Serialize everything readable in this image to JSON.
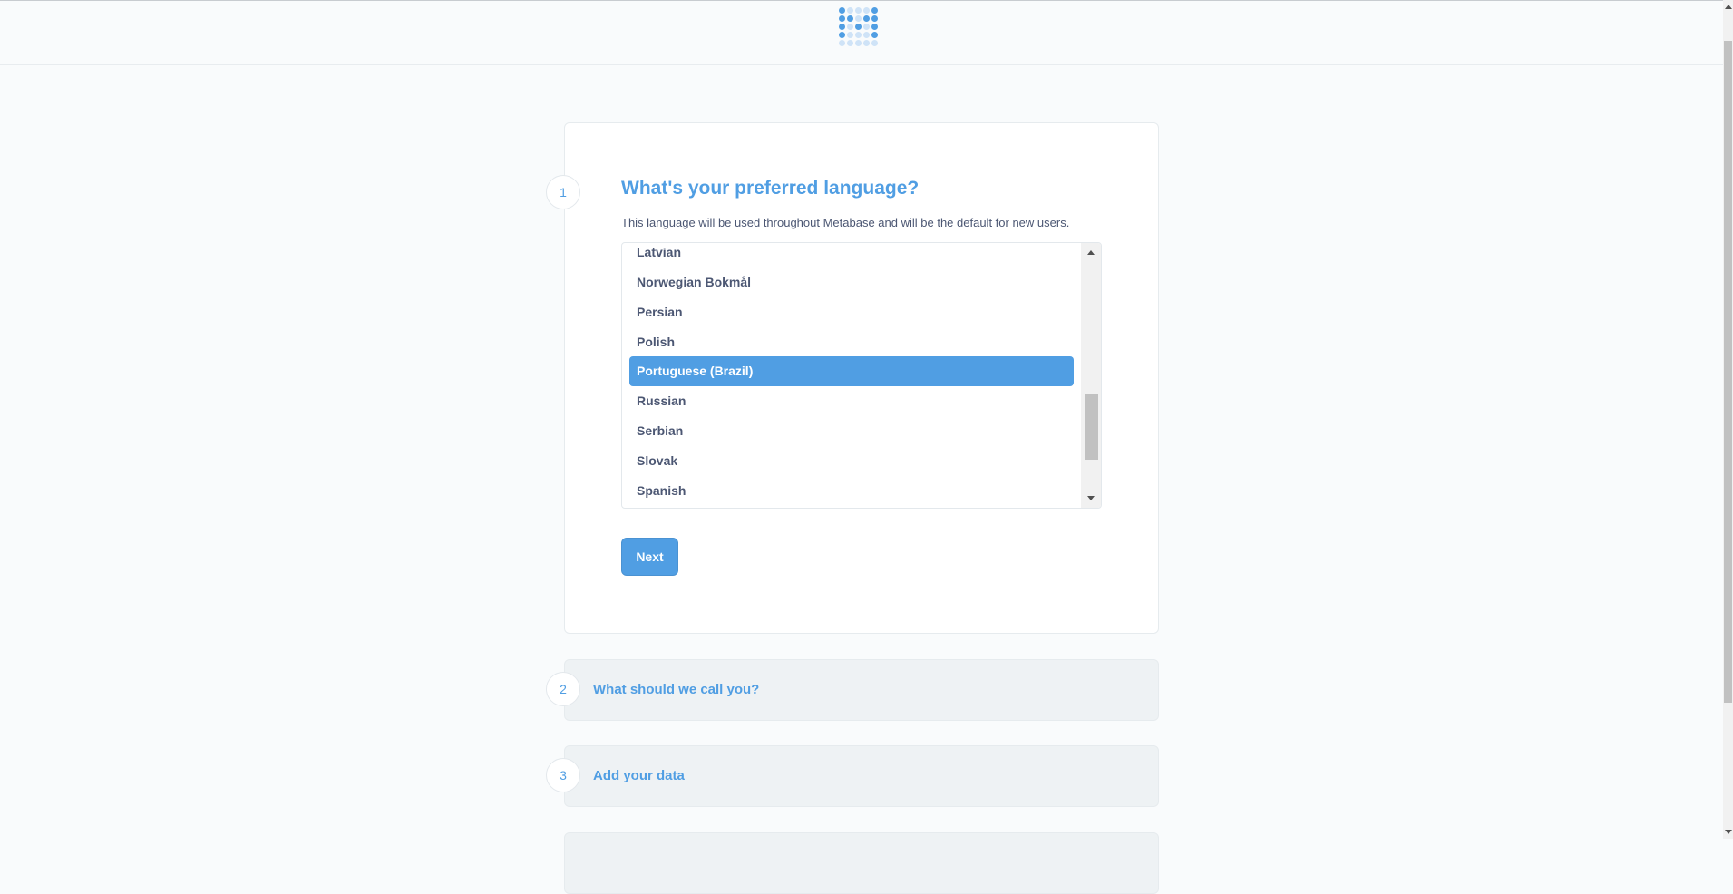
{
  "colors": {
    "brand": "#509ee3",
    "text_dark": "#4c5773",
    "background": "#f9fbfc"
  },
  "header": {
    "logo_icon": "metabase-logo"
  },
  "step1": {
    "number": "1",
    "title": "What's your preferred language?",
    "description": "This language will be used throughout Metabase and will be the default for new users.",
    "languages": [
      "Latvian",
      "Norwegian Bokmål",
      "Persian",
      "Polish",
      "Portuguese (Brazil)",
      "Russian",
      "Serbian",
      "Slovak",
      "Spanish"
    ],
    "selected": "Portuguese (Brazil)",
    "next_label": "Next"
  },
  "step2": {
    "number": "2",
    "title": "What should we call you?"
  },
  "step3": {
    "number": "3",
    "title": "Add your data"
  }
}
